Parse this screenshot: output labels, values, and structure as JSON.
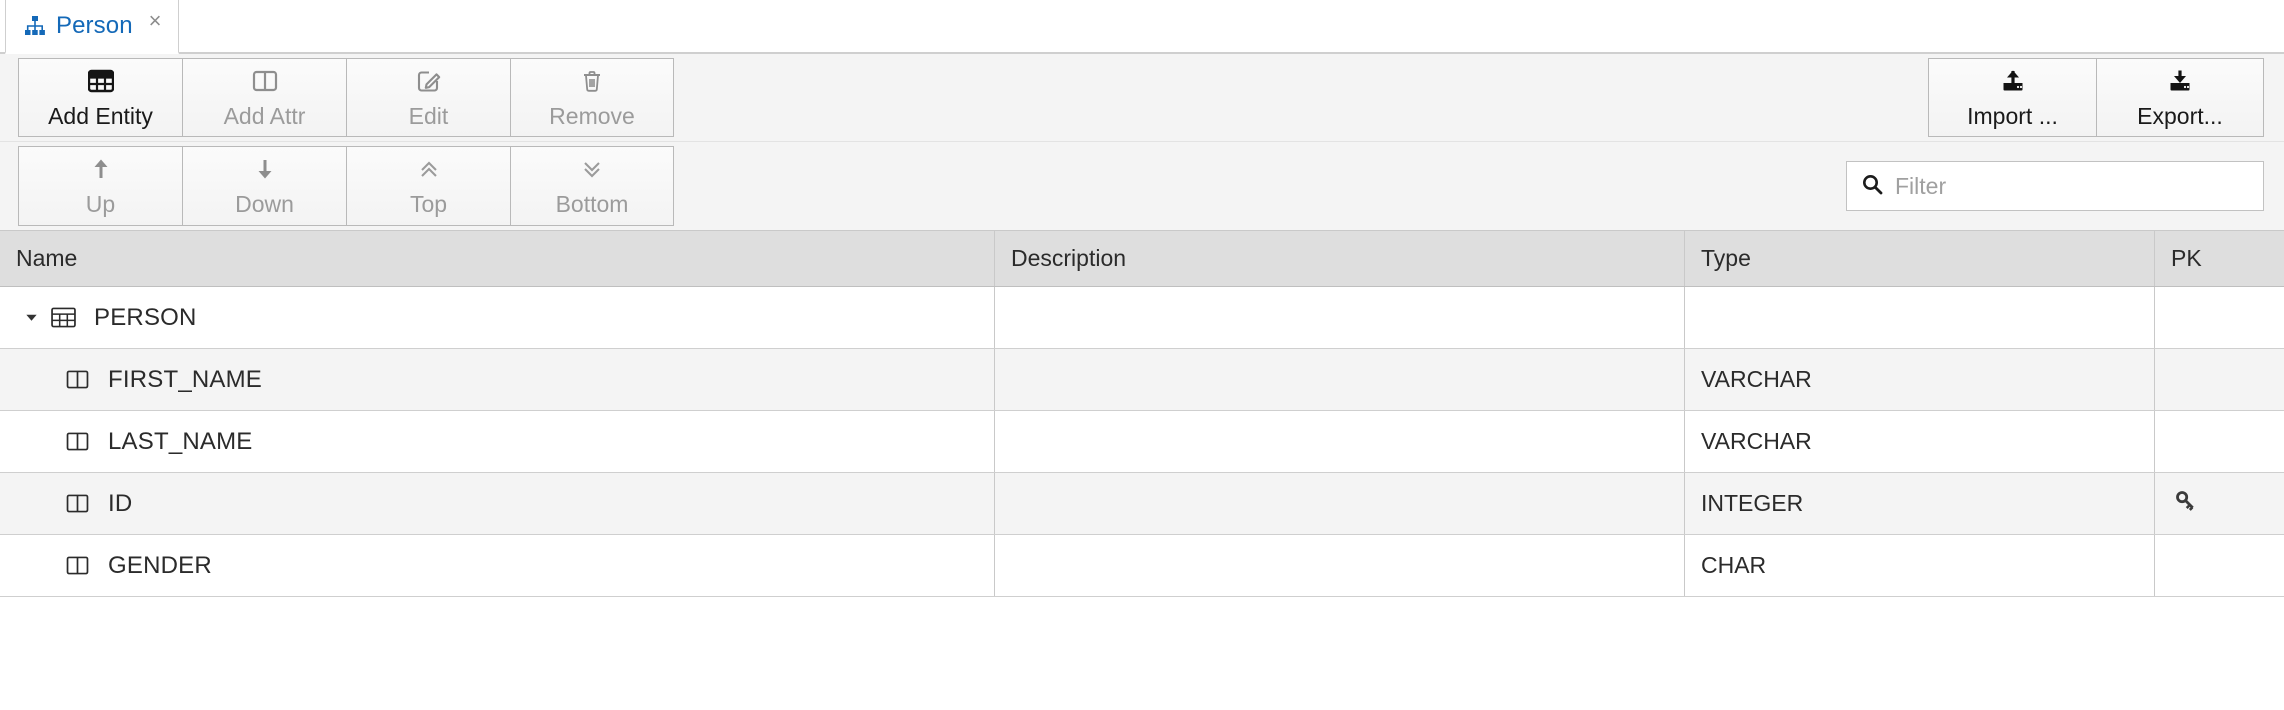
{
  "tab": {
    "icon": "hierarchy-icon",
    "label": "Person",
    "close": "×"
  },
  "toolbar_primary": {
    "buttons": [
      {
        "label": "Add Entity",
        "icon": "table-icon",
        "enabled": true
      },
      {
        "label": "Add Attr",
        "icon": "column-icon",
        "enabled": false
      },
      {
        "label": "Edit",
        "icon": "edit-pencil-icon",
        "enabled": false
      },
      {
        "label": "Remove",
        "icon": "trash-icon",
        "enabled": false
      }
    ],
    "right_buttons": [
      {
        "label": "Import ...",
        "icon": "upload-icon",
        "enabled": true
      },
      {
        "label": "Export...",
        "icon": "download-icon",
        "enabled": true
      }
    ]
  },
  "toolbar_secondary": {
    "buttons": [
      {
        "label": "Up",
        "icon": "arrow-up-icon",
        "enabled": false
      },
      {
        "label": "Down",
        "icon": "arrow-down-icon",
        "enabled": false
      },
      {
        "label": "Top",
        "icon": "double-chevron-up-icon",
        "enabled": false
      },
      {
        "label": "Bottom",
        "icon": "double-chevron-down-icon",
        "enabled": false
      }
    ],
    "filter": {
      "icon": "search-icon",
      "placeholder": "Filter",
      "value": ""
    }
  },
  "table": {
    "headers": {
      "name": "Name",
      "description": "Description",
      "type": "Type",
      "pk": "PK"
    },
    "rows": [
      {
        "name": "PERSON",
        "description": "",
        "type": "",
        "pk": "",
        "level": 0,
        "icon": "table-icon",
        "expanded": true
      },
      {
        "name": "FIRST_NAME",
        "description": "",
        "type": "VARCHAR",
        "pk": "",
        "level": 1,
        "icon": "column-icon"
      },
      {
        "name": "LAST_NAME",
        "description": "",
        "type": "VARCHAR",
        "pk": "",
        "level": 1,
        "icon": "column-icon"
      },
      {
        "name": "ID",
        "description": "",
        "type": "INTEGER",
        "pk": "key-icon",
        "level": 1,
        "icon": "column-icon"
      },
      {
        "name": "GENDER",
        "description": "",
        "type": "CHAR",
        "pk": "",
        "level": 1,
        "icon": "column-icon"
      }
    ]
  },
  "colors": {
    "tab_text": "#1469b8",
    "header_bg": "#dedede",
    "toolbar_bg": "#f4f4f4",
    "row_alt_bg": "#f4f4f4",
    "disabled_text": "#9b9b9b"
  }
}
